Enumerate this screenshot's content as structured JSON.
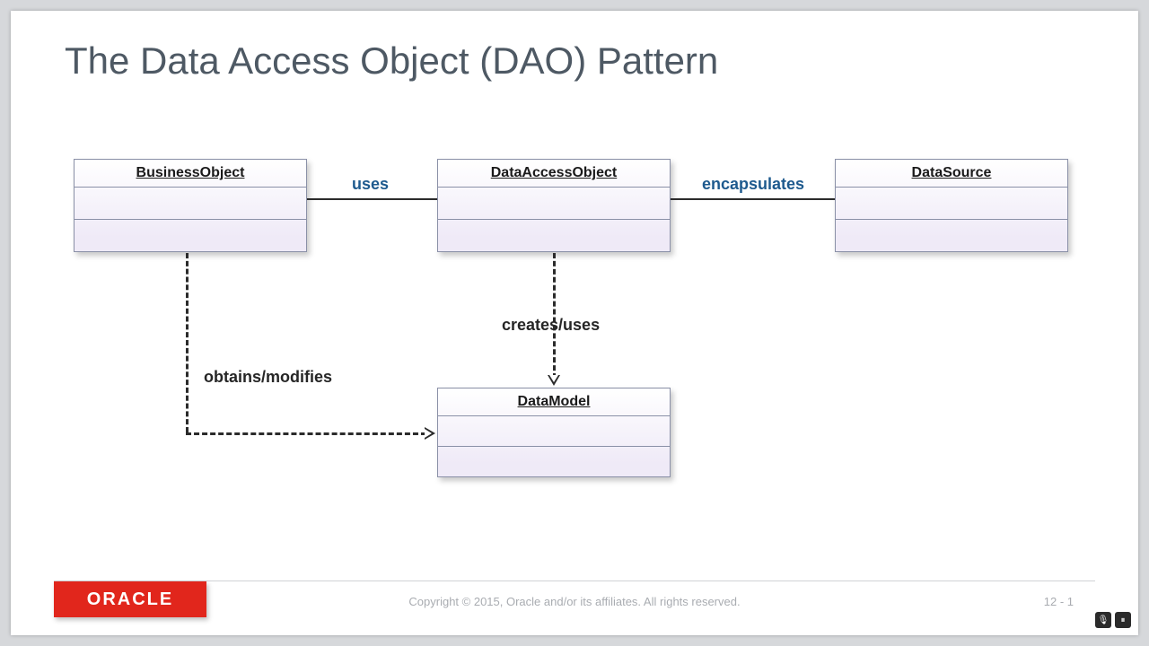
{
  "title": "The Data Access Object (DAO) Pattern",
  "nodes": {
    "business": "BusinessObject",
    "dao": "DataAccessObject",
    "datasource": "DataSource",
    "model": "DataModel"
  },
  "edges": {
    "uses": "uses",
    "encapsulates": "encapsulates",
    "creates_uses": "creates/uses",
    "obtains_modifies": "obtains/modifies"
  },
  "footer": {
    "brand": "ORACLE",
    "copyright": "Copyright © 2015, Oracle and/or its affiliates. All rights reserved.",
    "page": "12 - 1"
  },
  "tray": {
    "mic_glyph": "🎙",
    "pause_glyph": "⏸"
  }
}
